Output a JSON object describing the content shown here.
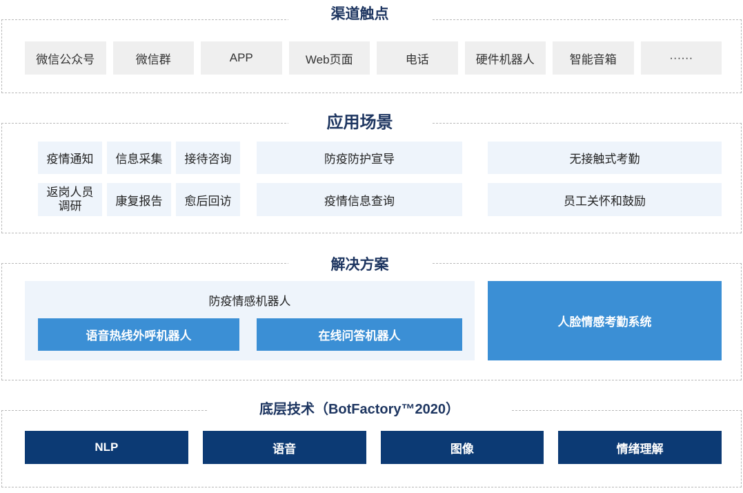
{
  "colors": {
    "title_text": "#1d3560",
    "channel_box": "#efefef",
    "scenario_box": "#eef4fb",
    "solution_blue": "#3b8fd5",
    "tech_navy": "#0c3a74",
    "dashed_border": "#b8b8b8"
  },
  "channels": {
    "title": "渠道触点",
    "items": [
      "微信公众号",
      "微信群",
      "APP",
      "Web页面",
      "电话",
      "硬件机器人",
      "智能音箱",
      "······"
    ]
  },
  "scenarios": {
    "title": "应用场景",
    "small": [
      "疫情通知",
      "信息采集",
      "接待咨询",
      "返岗人员调研",
      "康复报告",
      "愈后回访"
    ],
    "wide": [
      "防疫防护宣导",
      "疫情信息查询"
    ],
    "right": [
      "无接触式考勤",
      "员工关怀和鼓励"
    ]
  },
  "solutions": {
    "title": "解决方案",
    "robot_group": {
      "label": "防疫情感机器人",
      "items": [
        "语音热线外呼机器人",
        "在线问答机器人"
      ]
    },
    "face_system": "人脸情感考勤系统"
  },
  "foundation": {
    "title": "底层技术（BotFactory™2020）",
    "items": [
      "NLP",
      "语音",
      "图像",
      "情绪理解"
    ]
  }
}
